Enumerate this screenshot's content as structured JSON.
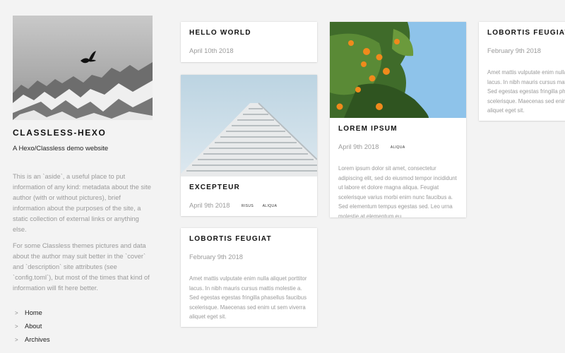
{
  "site": {
    "title": "CLASSLESS-HEXO",
    "description": "A Hexo/Classless demo website",
    "aside_paragraphs": [
      "This is an `aside`, a useful place to put information of any kind: metadata about the site author (with or without pictures), brief information about the purposes of the site, a static collection of external links or anything else.",
      "For some Classless themes pictures and data about the author may suit better in the `cover` and `description` site attributes (see `config.toml`), but most of the times that kind of information will fit here better."
    ],
    "nav": [
      "Home",
      "About",
      "Archives"
    ]
  },
  "posts": [
    {
      "title": "HELLO WORLD",
      "date": "April 10th 2018",
      "tags": [],
      "excerpt": ""
    },
    {
      "title": "EXCEPTEUR",
      "date": "April 9th 2018",
      "tags": [
        "RISUS",
        "ALIQUA"
      ],
      "excerpt": ""
    },
    {
      "title": "LOBORTIS FEUGIAT",
      "date": "February 9th 2018",
      "tags": [],
      "excerpt": "Amet mattis vulputate enim nulla aliquet porttitor lacus. In nibh mauris cursus mattis molestie a. Sed egestas egestas fringilla phasellus faucibus scelerisque. Maecenas sed enim ut sem viverra aliquet eget sit."
    },
    {
      "title": "LOREM IPSUM",
      "date": "April 9th 2018",
      "tags": [
        "ALIQUA"
      ],
      "excerpt": "Lorem ipsum dolor sit amet, consectetur adipiscing elit, sed do eiusmod tempor incididunt ut labore et dolore magna aliqua. Feugiat scelerisque varius morbi enim nunc faucibus a. Sed elementum tempus egestas sed. Leo urna molestie at elementum eu"
    },
    {
      "title": "LOBORTIS FEUGIAT",
      "date": "February 9th 2018",
      "tags": [],
      "excerpt": "Amet mattis vulputate enim nulla aliquet porttitor lacus. In nibh mauris cursus mattis molestie a. Sed egestas egestas fringilla phasellus faucibus scelerisque. Maecenas sed enim ut sem viverra aliquet eget sit."
    }
  ],
  "images": {
    "cover": "mountain-bird-photo",
    "excepteur": "building-architecture-photo",
    "lorem_ipsum": "orange-tree-photo"
  }
}
